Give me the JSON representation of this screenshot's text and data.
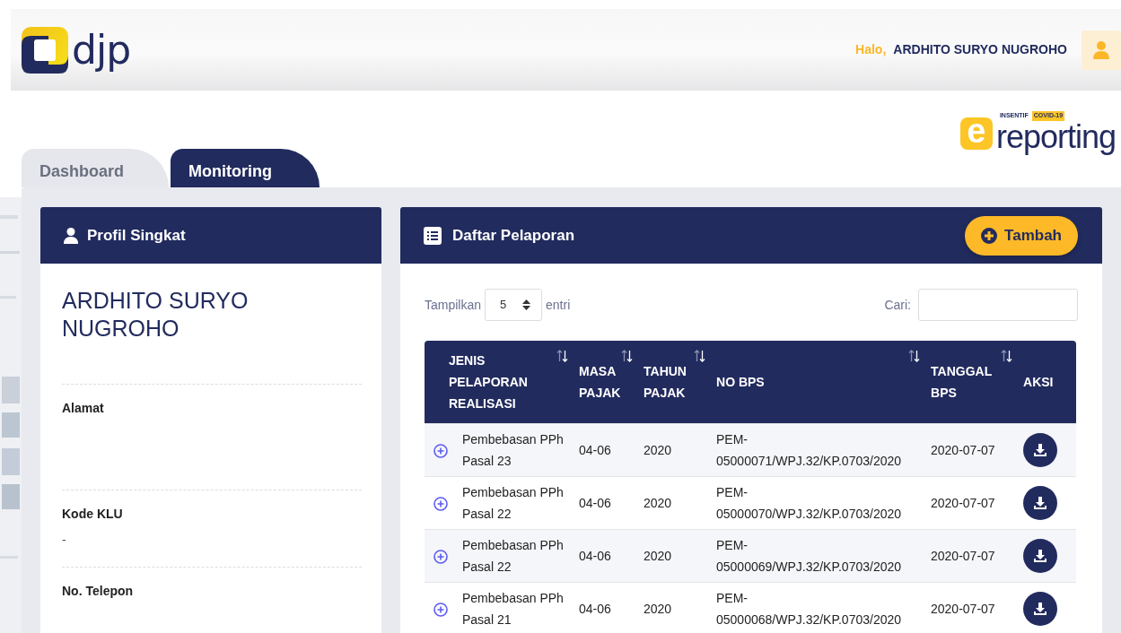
{
  "header": {
    "logo_text": "djp",
    "greeting": "Halo,",
    "user_name": "ARDHITO SURYO NUGROHO"
  },
  "tabs": [
    {
      "label": "Dashboard",
      "selected": false
    },
    {
      "label": "Monitoring",
      "selected": true
    }
  ],
  "brand": {
    "mark": "e",
    "tag": "INSENTIF",
    "badge": "COVID-19",
    "name": "reporting"
  },
  "profile": {
    "title": "Profil Singkat",
    "name": "ARDHITO SURYO NUGROHO",
    "fields": [
      {
        "label": "Alamat"
      },
      {
        "label": "Kode KLU",
        "value": "-"
      },
      {
        "label": "No. Telepon"
      }
    ]
  },
  "reports": {
    "title": "Daftar Pelaporan",
    "add_button": "Tambah",
    "show_label": "Tampilkan",
    "page_size": "5",
    "entries_label": "entri",
    "search_label": "Cari:",
    "table": {
      "columns": [
        {
          "label": "JENIS PELAPORAN REALISASI",
          "sortable": true
        },
        {
          "label": "MASA PAJAK",
          "sortable": true
        },
        {
          "label": "TAHUN PAJAK",
          "sortable": true
        },
        {
          "label": "NO BPS",
          "sortable": true
        },
        {
          "label": "TANGGAL BPS",
          "sortable": true
        },
        {
          "label": "AKSI",
          "sortable": false
        }
      ],
      "rows": [
        {
          "jenis": "Pembebasan PPh Pasal 23",
          "masa": "04-06",
          "tahun": "2020",
          "no_bps": "PEM-05000071/WPJ.32/KP.0703/2020",
          "tanggal": "2020-07-07"
        },
        {
          "jenis": "Pembebasan PPh Pasal 22",
          "masa": "04-06",
          "tahun": "2020",
          "no_bps": "PEM-05000070/WPJ.32/KP.0703/2020",
          "tanggal": "2020-07-07"
        },
        {
          "jenis": "Pembebasan PPh Pasal 22",
          "masa": "04-06",
          "tahun": "2020",
          "no_bps": "PEM-05000069/WPJ.32/KP.0703/2020",
          "tanggal": "2020-07-07"
        },
        {
          "jenis": "Pembebasan PPh Pasal 21",
          "masa": "04-06",
          "tahun": "2020",
          "no_bps": "PEM-05000068/WPJ.32/KP.0703/2020",
          "tanggal": "2020-07-07"
        }
      ]
    }
  }
}
